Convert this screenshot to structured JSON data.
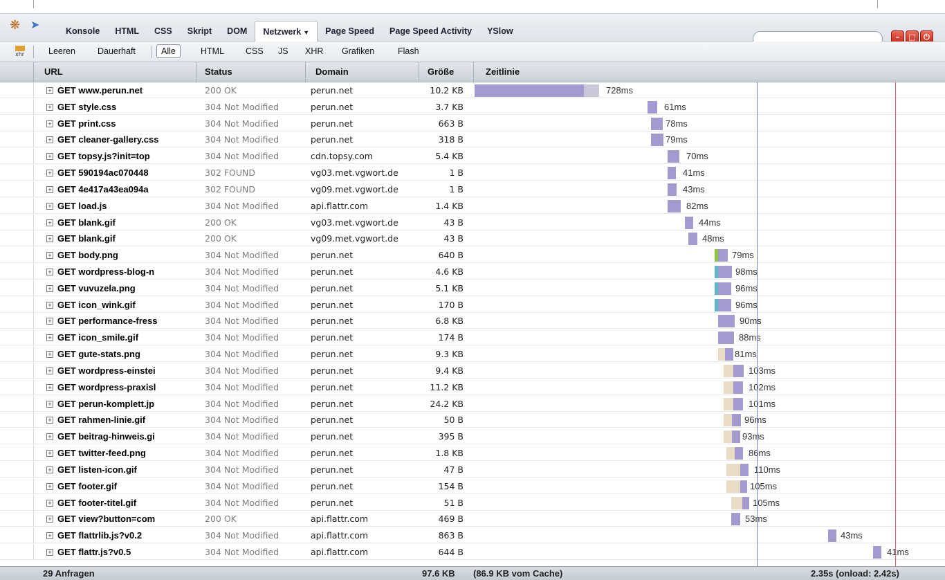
{
  "toolbar": {
    "tabs": [
      "Konsole",
      "HTML",
      "CSS",
      "Skript",
      "DOM",
      "Netzwerk",
      "Page Speed",
      "Page Speed Activity",
      "YSlow"
    ],
    "active_tab": "Netzwerk",
    "search_placeholder": "",
    "icons": [
      "firebug-icon",
      "inspect-icon",
      "minimize-icon",
      "detach-icon",
      "close-icon"
    ]
  },
  "filter_bar": {
    "clear_label": "Leeren",
    "persist_label": "Dauerhaft",
    "filters": [
      "Alle",
      "HTML",
      "CSS",
      "JS",
      "XHR",
      "Grafiken",
      "Flash"
    ],
    "active_filter": "Alle",
    "xhr_icon_label": "xhr"
  },
  "columns": {
    "url": "URL",
    "status": "Status",
    "domain": "Domain",
    "size": "Größe",
    "timeline": "Zeitlinie"
  },
  "requests": [
    {
      "url": "GET www.perun.net",
      "status": "200 OK",
      "domain": "perun.net",
      "size": "10.2 KB",
      "time": "728ms"
    },
    {
      "url": "GET style.css",
      "status": "304 Not Modified",
      "domain": "perun.net",
      "size": "3.7 KB",
      "time": "61ms"
    },
    {
      "url": "GET print.css",
      "status": "304 Not Modified",
      "domain": "perun.net",
      "size": "663 B",
      "time": "78ms"
    },
    {
      "url": "GET cleaner-gallery.css",
      "status": "304 Not Modified",
      "domain": "perun.net",
      "size": "318 B",
      "time": "79ms"
    },
    {
      "url": "GET topsy.js?init=top",
      "status": "304 Not Modified",
      "domain": "cdn.topsy.com",
      "size": "5.4 KB",
      "time": "70ms"
    },
    {
      "url": "GET 590194ac070448",
      "status": "302 FOUND",
      "domain": "vg03.met.vgwort.de",
      "size": "1 B",
      "time": "41ms"
    },
    {
      "url": "GET 4e417a43ea094a",
      "status": "302 FOUND",
      "domain": "vg09.met.vgwort.de",
      "size": "1 B",
      "time": "43ms"
    },
    {
      "url": "GET load.js",
      "status": "304 Not Modified",
      "domain": "api.flattr.com",
      "size": "1.4 KB",
      "time": "82ms"
    },
    {
      "url": "GET blank.gif",
      "status": "200 OK",
      "domain": "vg03.met.vgwort.de",
      "size": "43 B",
      "time": "44ms"
    },
    {
      "url": "GET blank.gif",
      "status": "200 OK",
      "domain": "vg09.met.vgwort.de",
      "size": "43 B",
      "time": "48ms"
    },
    {
      "url": "GET body.png",
      "status": "304 Not Modified",
      "domain": "perun.net",
      "size": "640 B",
      "time": "79ms"
    },
    {
      "url": "GET wordpress-blog-n",
      "status": "304 Not Modified",
      "domain": "perun.net",
      "size": "4.6 KB",
      "time": "98ms"
    },
    {
      "url": "GET vuvuzela.png",
      "status": "304 Not Modified",
      "domain": "perun.net",
      "size": "5.1 KB",
      "time": "96ms"
    },
    {
      "url": "GET icon_wink.gif",
      "status": "304 Not Modified",
      "domain": "perun.net",
      "size": "170 B",
      "time": "96ms"
    },
    {
      "url": "GET performance-fress",
      "status": "304 Not Modified",
      "domain": "perun.net",
      "size": "6.8 KB",
      "time": "90ms"
    },
    {
      "url": "GET icon_smile.gif",
      "status": "304 Not Modified",
      "domain": "perun.net",
      "size": "174 B",
      "time": "88ms"
    },
    {
      "url": "GET gute-stats.png",
      "status": "304 Not Modified",
      "domain": "perun.net",
      "size": "9.3 KB",
      "time": "81ms"
    },
    {
      "url": "GET wordpress-einstei",
      "status": "304 Not Modified",
      "domain": "perun.net",
      "size": "9.4 KB",
      "time": "103ms"
    },
    {
      "url": "GET wordpress-praxisl",
      "status": "304 Not Modified",
      "domain": "perun.net",
      "size": "11.2 KB",
      "time": "102ms"
    },
    {
      "url": "GET perun-komplett.jp",
      "status": "304 Not Modified",
      "domain": "perun.net",
      "size": "24.2 KB",
      "time": "101ms"
    },
    {
      "url": "GET rahmen-linie.gif",
      "status": "304 Not Modified",
      "domain": "perun.net",
      "size": "50 B",
      "time": "96ms"
    },
    {
      "url": "GET beitrag-hinweis.gi",
      "status": "304 Not Modified",
      "domain": "perun.net",
      "size": "395 B",
      "time": "93ms"
    },
    {
      "url": "GET twitter-feed.png",
      "status": "304 Not Modified",
      "domain": "perun.net",
      "size": "1.8 KB",
      "time": "86ms"
    },
    {
      "url": "GET listen-icon.gif",
      "status": "304 Not Modified",
      "domain": "perun.net",
      "size": "47 B",
      "time": "110ms"
    },
    {
      "url": "GET footer.gif",
      "status": "304 Not Modified",
      "domain": "perun.net",
      "size": "154 B",
      "time": "105ms"
    },
    {
      "url": "GET footer-titel.gif",
      "status": "304 Not Modified",
      "domain": "perun.net",
      "size": "51 B",
      "time": "105ms"
    },
    {
      "url": "GET view?button=com",
      "status": "200 OK",
      "domain": "api.flattr.com",
      "size": "469 B",
      "time": "53ms"
    },
    {
      "url": "GET flattrlib.js?v0.2",
      "status": "304 Not Modified",
      "domain": "api.flattr.com",
      "size": "863 B",
      "time": "43ms"
    },
    {
      "url": "GET flattr.js?v0.5",
      "status": "304 Not Modified",
      "domain": "api.flattr.com",
      "size": "644 B",
      "time": "41ms"
    }
  ],
  "summary": {
    "count": "29 Anfragen",
    "size": "97.6 KB",
    "cache": "(86.9 KB vom Cache)",
    "timing": "2.35s (onload: 2.42s)"
  },
  "colors": {
    "bar_receive": "#a59ad0",
    "bar_wait": "#c8c8d8",
    "bar_dns": "#8dc63f",
    "bar_connect": "#5bb8c8",
    "bar_blocked": "#e9dcc6",
    "domcontent_line": "#6f7fd8",
    "onload_line": "#e06060"
  }
}
